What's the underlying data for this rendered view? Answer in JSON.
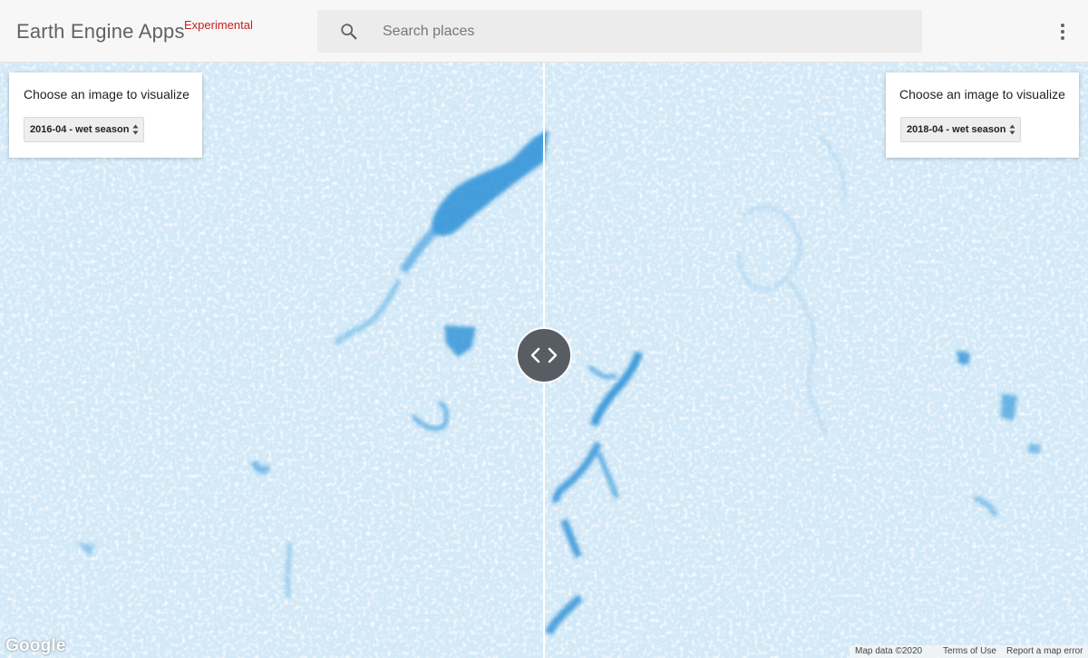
{
  "header": {
    "brand": "Earth Engine Apps",
    "brand_tag": "Experimental",
    "search_placeholder": "Search places"
  },
  "left_panel": {
    "title": "Choose an image to visualize",
    "selected": "2016-04 - wet season"
  },
  "right_panel": {
    "title": "Choose an image to visualize",
    "selected": "2018-04 - wet season"
  },
  "map": {
    "logo": "Google",
    "map_data": "Map data ©2020",
    "terms": "Terms of Use",
    "report": "Report a map error",
    "water_color": "#2a8fd6",
    "land_color": "#dceef9"
  },
  "icons": {
    "search": "search-icon",
    "menu": "more-vert-icon",
    "handle": "code-arrows-icon"
  }
}
